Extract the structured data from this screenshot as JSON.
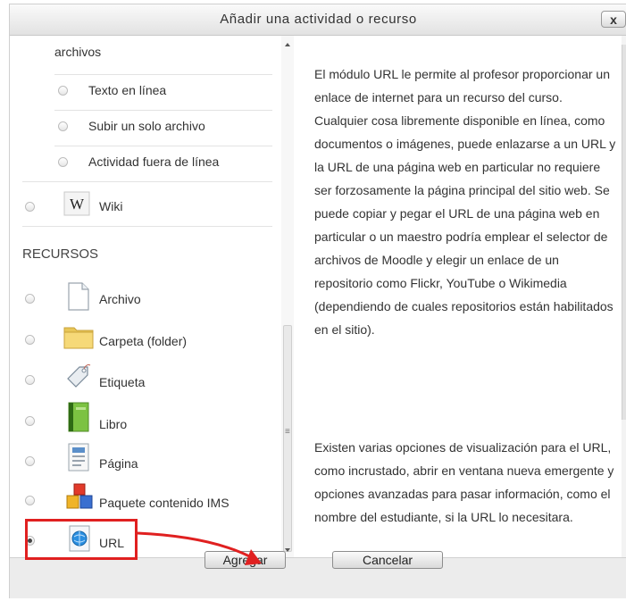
{
  "dialog": {
    "title": "Añadir una actividad o recurso",
    "close_label": "x"
  },
  "list": {
    "partial_item": "archivos",
    "sub_items": [
      {
        "label": "Texto en línea"
      },
      {
        "label": "Subir un solo archivo"
      },
      {
        "label": "Actividad fuera de línea"
      }
    ],
    "activities": [
      {
        "label": "Wiki",
        "icon": "wiki-icon"
      }
    ],
    "section_header": "RECURSOS",
    "resources": [
      {
        "label": "Archivo",
        "icon": "file-icon"
      },
      {
        "label": "Carpeta (folder)",
        "icon": "folder-icon"
      },
      {
        "label": "Etiqueta",
        "icon": "label-tag-icon"
      },
      {
        "label": "Libro",
        "icon": "book-icon"
      },
      {
        "label": "Página",
        "icon": "page-icon"
      },
      {
        "label": "Paquete contenido IMS",
        "icon": "ims-package-icon"
      },
      {
        "label": "URL",
        "icon": "url-icon",
        "selected": true
      }
    ]
  },
  "description": {
    "paragraph1": "El módulo URL le permite al profesor proporcionar un enlace de internet para un recurso del curso. Cualquier cosa libremente disponible en línea, como documentos o imágenes, puede enlazarse a un URL y la URL de una página web en particular no requiere ser forzosamente la página principal del sitio web. Se puede copiar y pegar el URL de una página web en particular o un maestro podría emplear el selector de archivos de Moodle y elegir un enlace de un repositorio como Flickr, YouTube o Wikimedia (dependiendo de cuales repositorios están habilitados en el sitio).",
    "paragraph2": "Existen varias opciones de visualización para el URL, como incrustado, abrir en ventana nueva emergente y opciones avanzadas para pasar información, como el nombre del estudiante, si la URL lo necesitara."
  },
  "footer": {
    "add_button": "Agregar",
    "cancel_button": "Cancelar"
  },
  "colors": {
    "highlight": "#e02020",
    "title_text": "#333333"
  }
}
